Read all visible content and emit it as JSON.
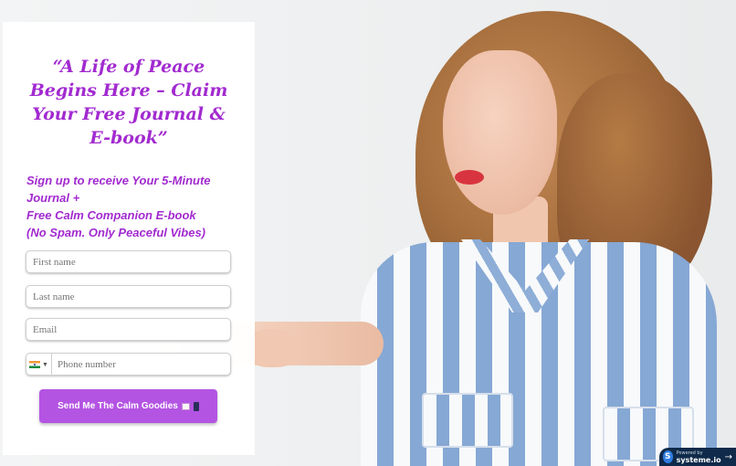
{
  "hero": {
    "image_description_icon": "woman-portrait-illustration"
  },
  "form": {
    "headline": "“A Life of Peace Begins Here – Claim Your Free Journal & E-book”",
    "subhead_line1": "Sign up to receive Your 5-Minute Journal +",
    "subhead_line2": "Free Calm Companion E-book",
    "subhead_line3": "(No Spam. Only Peaceful Vibes)",
    "first_name_placeholder": "First name",
    "last_name_placeholder": "Last name",
    "email_placeholder": "Email",
    "phone_placeholder": "Phone number",
    "country_flag_icon": "india-flag-icon",
    "submit_label": "Send Me The Calm Goodies",
    "submit_icons": [
      "envelope-emoji",
      "phone-emoji"
    ]
  },
  "badge": {
    "powered_by": "Powered by",
    "brand": "systeme.io",
    "logo_letter": "S"
  },
  "colors": {
    "accent": "#a22ad0",
    "button": "#b454e3",
    "badge_bg": "#0f2a4a"
  }
}
